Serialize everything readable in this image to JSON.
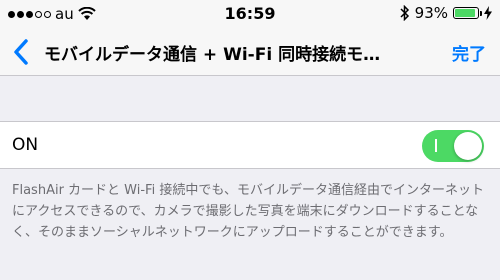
{
  "status_bar": {
    "carrier": "au",
    "time": "16:59",
    "battery": "93%",
    "battery_level": 0.93,
    "icons": [
      "signal-dots-icon",
      "wifi-icon",
      "bluetooth-icon",
      "battery-icon",
      "charging-icon"
    ]
  },
  "nav": {
    "title": "モバイルデータ通信 + Wi-Fi 同時接続モ…",
    "done_label": "完了",
    "back_icon": "chevron-left-icon",
    "accent_color": "#007aff"
  },
  "setting": {
    "label": "ON",
    "toggle_on": true,
    "toggle_color": "#4cd964"
  },
  "footer_text": "FlashAir カードと Wi-Fi 接続中でも、モバイルデータ通信経由でインターネットにアクセスできるので、カメラで撮影した写真を端末にダウンロードすることなく、そのままソーシャルネットワークにアップロードすることができます。"
}
